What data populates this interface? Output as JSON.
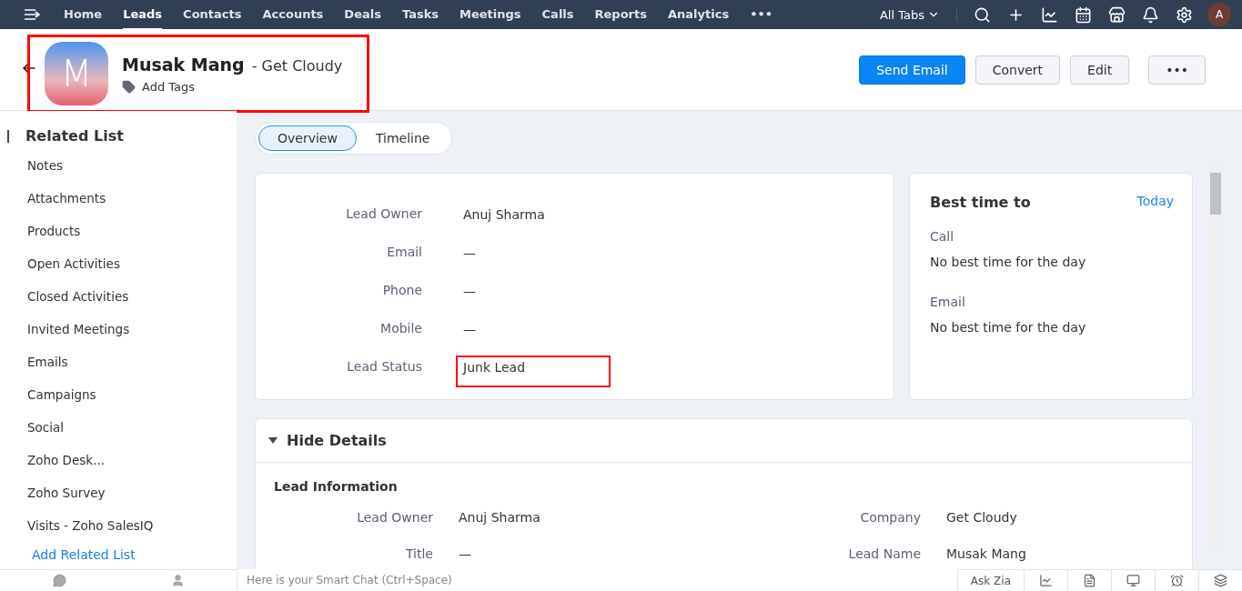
{
  "nav": {
    "tabs": [
      {
        "label": "Home",
        "selected": false
      },
      {
        "label": "Leads",
        "selected": true
      },
      {
        "label": "Contacts",
        "selected": false
      },
      {
        "label": "Accounts",
        "selected": false
      },
      {
        "label": "Deals",
        "selected": false
      },
      {
        "label": "Tasks",
        "selected": false
      },
      {
        "label": "Meetings",
        "selected": false
      },
      {
        "label": "Calls",
        "selected": false
      },
      {
        "label": "Reports",
        "selected": false
      },
      {
        "label": "Analytics",
        "selected": false
      }
    ],
    "more": "•••",
    "all_tabs": "All Tabs",
    "avatar": "A"
  },
  "record": {
    "initial": "M",
    "name": "Musak Mang",
    "company": "- Get Cloudy",
    "add_tags": "Add Tags",
    "highlighted": true
  },
  "actions": [
    {
      "label": "Send Email",
      "kind": "primary"
    },
    {
      "label": "Convert",
      "kind": "plain"
    },
    {
      "label": "Edit",
      "kind": "plain"
    },
    {
      "label": "•••",
      "kind": "more"
    }
  ],
  "sidebar": {
    "title": "Related List",
    "items": [
      "Notes",
      "Attachments",
      "Products",
      "Open Activities",
      "Closed Activities",
      "Invited Meetings",
      "Emails",
      "Campaigns",
      "Social",
      "Zoho Desk...",
      "Zoho Survey",
      "Visits - Zoho SalesIQ"
    ],
    "add": "Add Related List"
  },
  "view_tabs": [
    {
      "label": "Overview",
      "selected": true
    },
    {
      "label": "Timeline",
      "selected": false
    }
  ],
  "overview": [
    {
      "label": "Lead Owner",
      "value": "Anuj Sharma",
      "highlighted": false
    },
    {
      "label": "Email",
      "value": "—",
      "highlighted": false
    },
    {
      "label": "Phone",
      "value": "—",
      "highlighted": false
    },
    {
      "label": "Mobile",
      "value": "—",
      "highlighted": false
    },
    {
      "label": "Lead Status",
      "value": "Junk Lead",
      "highlighted": true
    }
  ],
  "best_time": {
    "title": "Best time to",
    "link": "Today",
    "items": [
      {
        "label": "Call",
        "value": "No best time for the day"
      },
      {
        "label": "Email",
        "value": "No best time for the day"
      }
    ]
  },
  "details": {
    "toggle": "Hide Details",
    "expanded": true,
    "section": "Lead Information",
    "rows": [
      {
        "left_label": "Lead Owner",
        "left_value": "Anuj Sharma",
        "right_label": "Company",
        "right_value": "Get Cloudy"
      },
      {
        "left_label": "Title",
        "left_value": "—",
        "right_label": "Lead Name",
        "right_value": "Musak Mang"
      }
    ]
  },
  "bottom_bar": {
    "chat_placeholder": "Here is your Smart Chat (Ctrl+Space)",
    "ask_zia": "Ask Zia"
  }
}
